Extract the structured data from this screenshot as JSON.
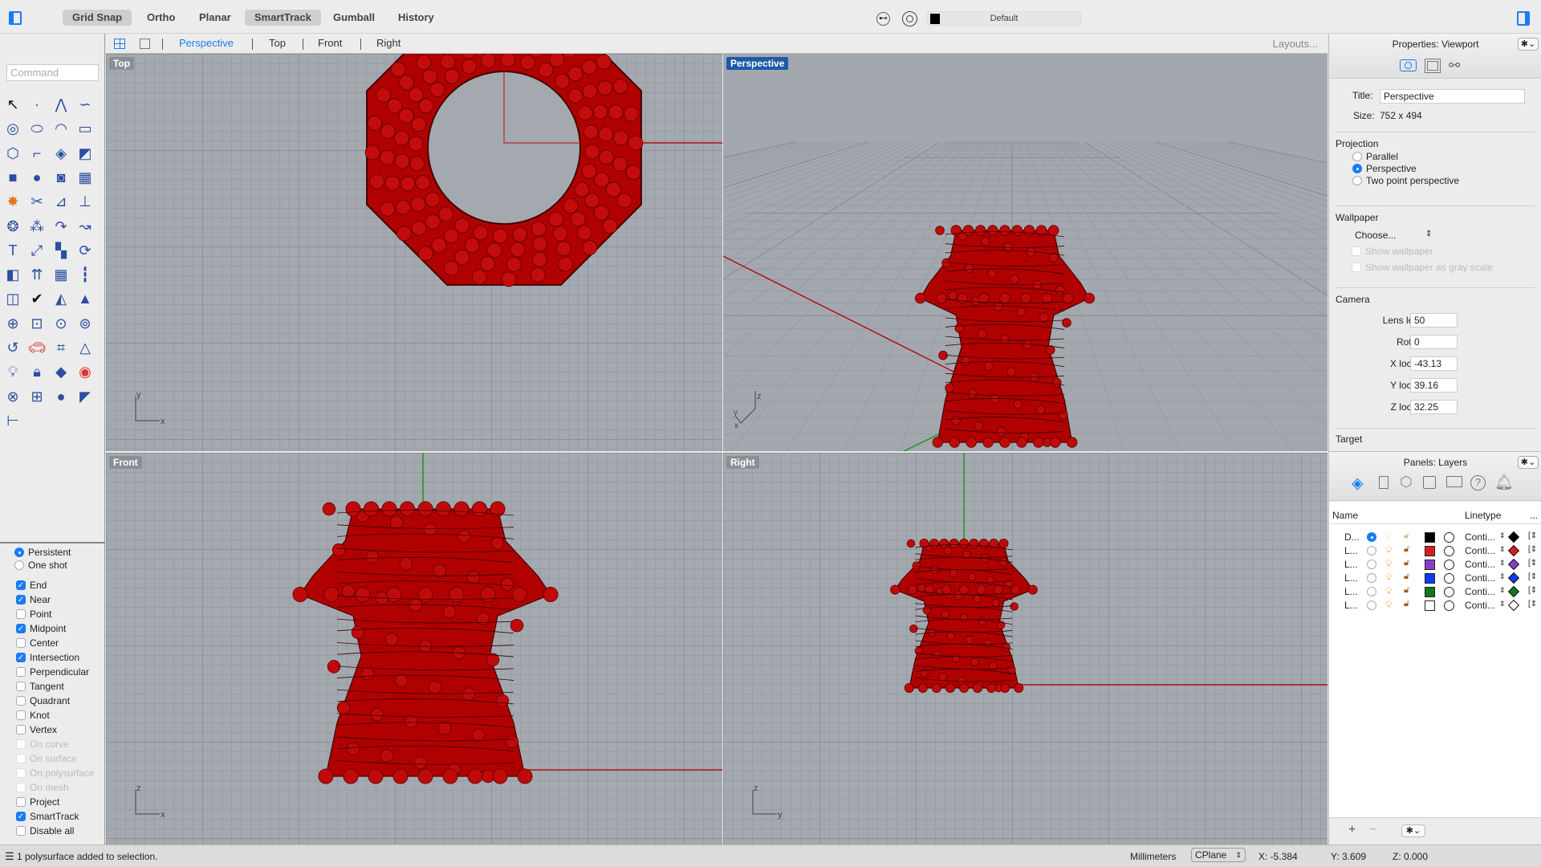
{
  "toolbar": {
    "toggles": [
      {
        "label": "Grid Snap",
        "on": true
      },
      {
        "label": "Ortho",
        "on": false
      },
      {
        "label": "Planar",
        "on": false
      },
      {
        "label": "SmartTrack",
        "on": true
      },
      {
        "label": "Gumball",
        "on": false
      },
      {
        "label": "History",
        "on": false
      }
    ],
    "layer_name": "Default",
    "layer_color": "#000000"
  },
  "tabs": {
    "items": [
      "Perspective",
      "Top",
      "Front",
      "Right"
    ],
    "active": "Perspective",
    "layouts": "Layouts..."
  },
  "command": {
    "placeholder": "Command"
  },
  "tools": [
    "select-arrow",
    "point",
    "polyline",
    "curve",
    "circle",
    "ellipse",
    "arc",
    "rectangle",
    "polygon",
    "fillet-curve",
    "surface-from-points",
    "sweep-surface",
    "box",
    "boolean-union",
    "extrude-surface",
    "surface-grid",
    "explode",
    "split",
    "trim",
    "extend",
    "boolean-shapes",
    "group",
    "curve-on-surface",
    "offset",
    "text",
    "move",
    "array",
    "rotate",
    "solid-tools",
    "extrude-arrows",
    "array-grid",
    "section",
    "split-panels",
    "check",
    "shade",
    "light-pyramid",
    "zoom-in",
    "zoom-window",
    "zoom-extents",
    "zoom-selected",
    "rotate-view",
    "car-render",
    "named-cplane",
    "grouped-shapes",
    "light",
    "lock",
    "layer-state",
    "color-wheel",
    "sphere-shaded",
    "sphere-grid",
    "render-sphere",
    "spot-light",
    "dimension"
  ],
  "snaps": {
    "modes": [
      {
        "label": "Persistent",
        "on": true
      },
      {
        "label": "One shot",
        "on": false
      }
    ],
    "items": [
      {
        "label": "End",
        "on": true
      },
      {
        "label": "Near",
        "on": true
      },
      {
        "label": "Point",
        "on": false
      },
      {
        "label": "Midpoint",
        "on": true
      },
      {
        "label": "Center",
        "on": false
      },
      {
        "label": "Intersection",
        "on": true
      },
      {
        "label": "Perpendicular",
        "on": false
      },
      {
        "label": "Tangent",
        "on": false
      },
      {
        "label": "Quadrant",
        "on": false
      },
      {
        "label": "Knot",
        "on": false
      },
      {
        "label": "Vertex",
        "on": false
      },
      {
        "label": "On curve",
        "on": false,
        "disabled": true
      },
      {
        "label": "On surface",
        "on": false,
        "disabled": true
      },
      {
        "label": "On polysurface",
        "on": false,
        "disabled": true
      },
      {
        "label": "On mesh",
        "on": false,
        "disabled": true
      },
      {
        "label": "Project",
        "on": false
      },
      {
        "label": "SmartTrack",
        "on": true
      },
      {
        "label": "Disable all",
        "on": false
      }
    ]
  },
  "viewports": {
    "top": {
      "label": "Top",
      "axis1": "y",
      "axis2": "x"
    },
    "perspective": {
      "label": "Perspective",
      "axis1": "z",
      "axis2": "y",
      "axis3": "x"
    },
    "front": {
      "label": "Front",
      "axis1": "z",
      "axis2": "x"
    },
    "right": {
      "label": "Right",
      "axis1": "z",
      "axis2": "y"
    }
  },
  "object_color": "#b00000",
  "properties": {
    "header": "Properties: Viewport",
    "title_label": "Title:",
    "title_value": "Perspective",
    "size_label": "Size:",
    "size_value": "752 x 494",
    "projection_label": "Projection",
    "projection_options": [
      {
        "label": "Parallel",
        "on": false
      },
      {
        "label": "Perspective",
        "on": true
      },
      {
        "label": "Two point perspective",
        "on": false
      }
    ],
    "wallpaper_label": "Wallpaper",
    "wallpaper_choose": "Choose...",
    "show_wallpaper": "Show wallpaper",
    "show_gray": "Show wallpaper as gray scale",
    "camera_label": "Camera",
    "camera": [
      {
        "label": "Lens length:",
        "value": "50"
      },
      {
        "label": "Rotation:",
        "value": "0"
      },
      {
        "label": "X location:",
        "value": "-43.13"
      },
      {
        "label": "Y location:",
        "value": "39.16"
      },
      {
        "label": "Z location:",
        "value": "32.25"
      }
    ],
    "target_label": "Target"
  },
  "layers": {
    "header": "Panels: Layers",
    "col_name": "Name",
    "col_linetype": "Linetype",
    "col_more": "...",
    "rows": [
      {
        "name": "D...",
        "current": true,
        "color": "#000000",
        "linetype": "Conti..."
      },
      {
        "name": "L...",
        "current": false,
        "color": "#dd1c1c",
        "linetype": "Conti..."
      },
      {
        "name": "L...",
        "current": false,
        "color": "#8a3fcc",
        "linetype": "Conti..."
      },
      {
        "name": "L...",
        "current": false,
        "color": "#0a3cf0",
        "linetype": "Conti..."
      },
      {
        "name": "L...",
        "current": false,
        "color": "#117a1a",
        "linetype": "Conti..."
      },
      {
        "name": "L...",
        "current": false,
        "color": "#ffffff",
        "linetype": "Conti..."
      }
    ]
  },
  "status": {
    "message": "1 polysurface added to selection.",
    "units": "Millimeters",
    "cplane": "CPlane",
    "x": "X: -5.384",
    "y": "Y: 3.609",
    "z": "Z: 0.000"
  }
}
